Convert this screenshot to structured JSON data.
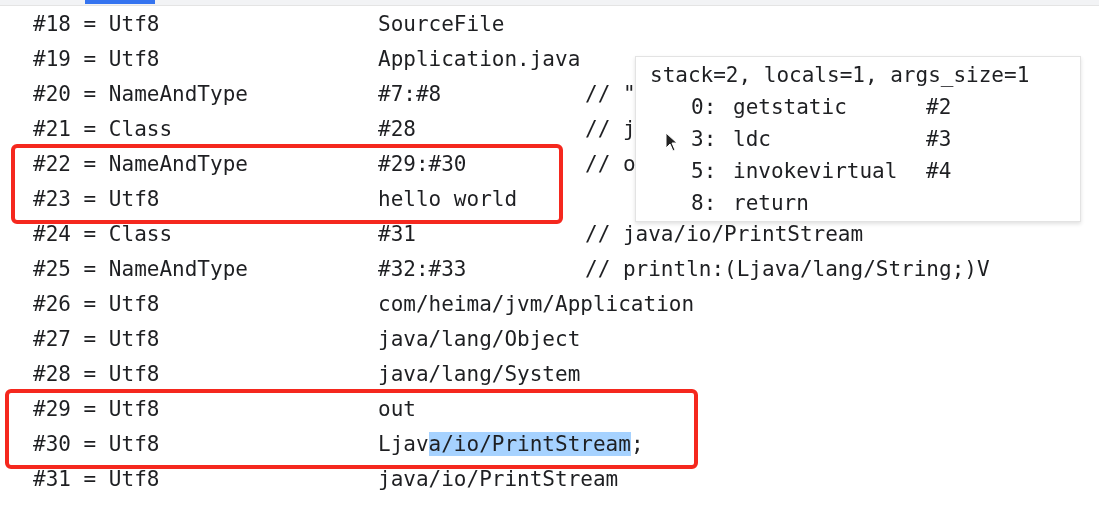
{
  "rows": [
    {
      "entry": "#18 = Utf8",
      "value_parts": [
        {
          "text": "SourceFile",
          "selected": false
        }
      ],
      "boxed": false
    },
    {
      "entry": "#19 = Utf8",
      "value_parts": [
        {
          "text": "Application.java",
          "selected": false
        }
      ],
      "boxed": false
    },
    {
      "entry": "#20 = NameAndType",
      "value_parts": [
        {
          "text": "#7:#8",
          "selected": false
        }
      ],
      "comment": "// \"",
      "boxed": false
    },
    {
      "entry": "#21 = Class",
      "value_parts": [
        {
          "text": "#28",
          "selected": false
        }
      ],
      "comment": "// j",
      "boxed": false
    },
    {
      "entry": "#22 = NameAndType",
      "value_parts": [
        {
          "text": "#29:#30",
          "selected": false
        }
      ],
      "comment": "// o",
      "boxed": true
    },
    {
      "entry": "#23 = Utf8",
      "value_parts": [
        {
          "text": "hello world",
          "selected": false
        }
      ],
      "boxed": true
    },
    {
      "entry": "#24 = Class",
      "value_parts": [
        {
          "text": "#31",
          "selected": false
        }
      ],
      "comment": "// java/io/PrintStream",
      "boxed": false
    },
    {
      "entry": "#25 = NameAndType",
      "value_parts": [
        {
          "text": "#32:#33",
          "selected": false
        }
      ],
      "comment": "// println:(Ljava/lang/String;)V",
      "boxed": false
    },
    {
      "entry": "#26 = Utf8",
      "value_parts": [
        {
          "text": "com/heima/jvm/Application",
          "selected": false
        }
      ],
      "boxed": false
    },
    {
      "entry": "#27 = Utf8",
      "value_parts": [
        {
          "text": "java/lang/Object",
          "selected": false
        }
      ],
      "boxed": false
    },
    {
      "entry": "#28 = Utf8",
      "value_parts": [
        {
          "text": "java/lang/System",
          "selected": false
        }
      ],
      "boxed": false
    },
    {
      "entry": "#29 = Utf8",
      "value_parts": [
        {
          "text": "out",
          "selected": false
        }
      ],
      "boxed": true
    },
    {
      "entry": "#30 = Utf8",
      "value_parts": [
        {
          "text": "Ljav",
          "selected": false
        },
        {
          "text": "a/io/PrintStream",
          "selected": true
        },
        {
          "text": ";",
          "selected": false
        }
      ],
      "boxed": true
    },
    {
      "entry": "#31 = Utf8",
      "value_parts": [
        {
          "text": "java/io/PrintStream",
          "selected": false
        }
      ],
      "boxed": false
    }
  ],
  "tooltip": {
    "header": "stack=2, locals=1, args_size=1",
    "instructions": [
      {
        "offset": "0:",
        "opcode": "getstatic",
        "arg": "#2"
      },
      {
        "offset": "3:",
        "opcode": "ldc",
        "arg": "#3"
      },
      {
        "offset": "5:",
        "opcode": "invokevirtual",
        "arg": "#4"
      },
      {
        "offset": "8:",
        "opcode": "return"
      }
    ]
  }
}
